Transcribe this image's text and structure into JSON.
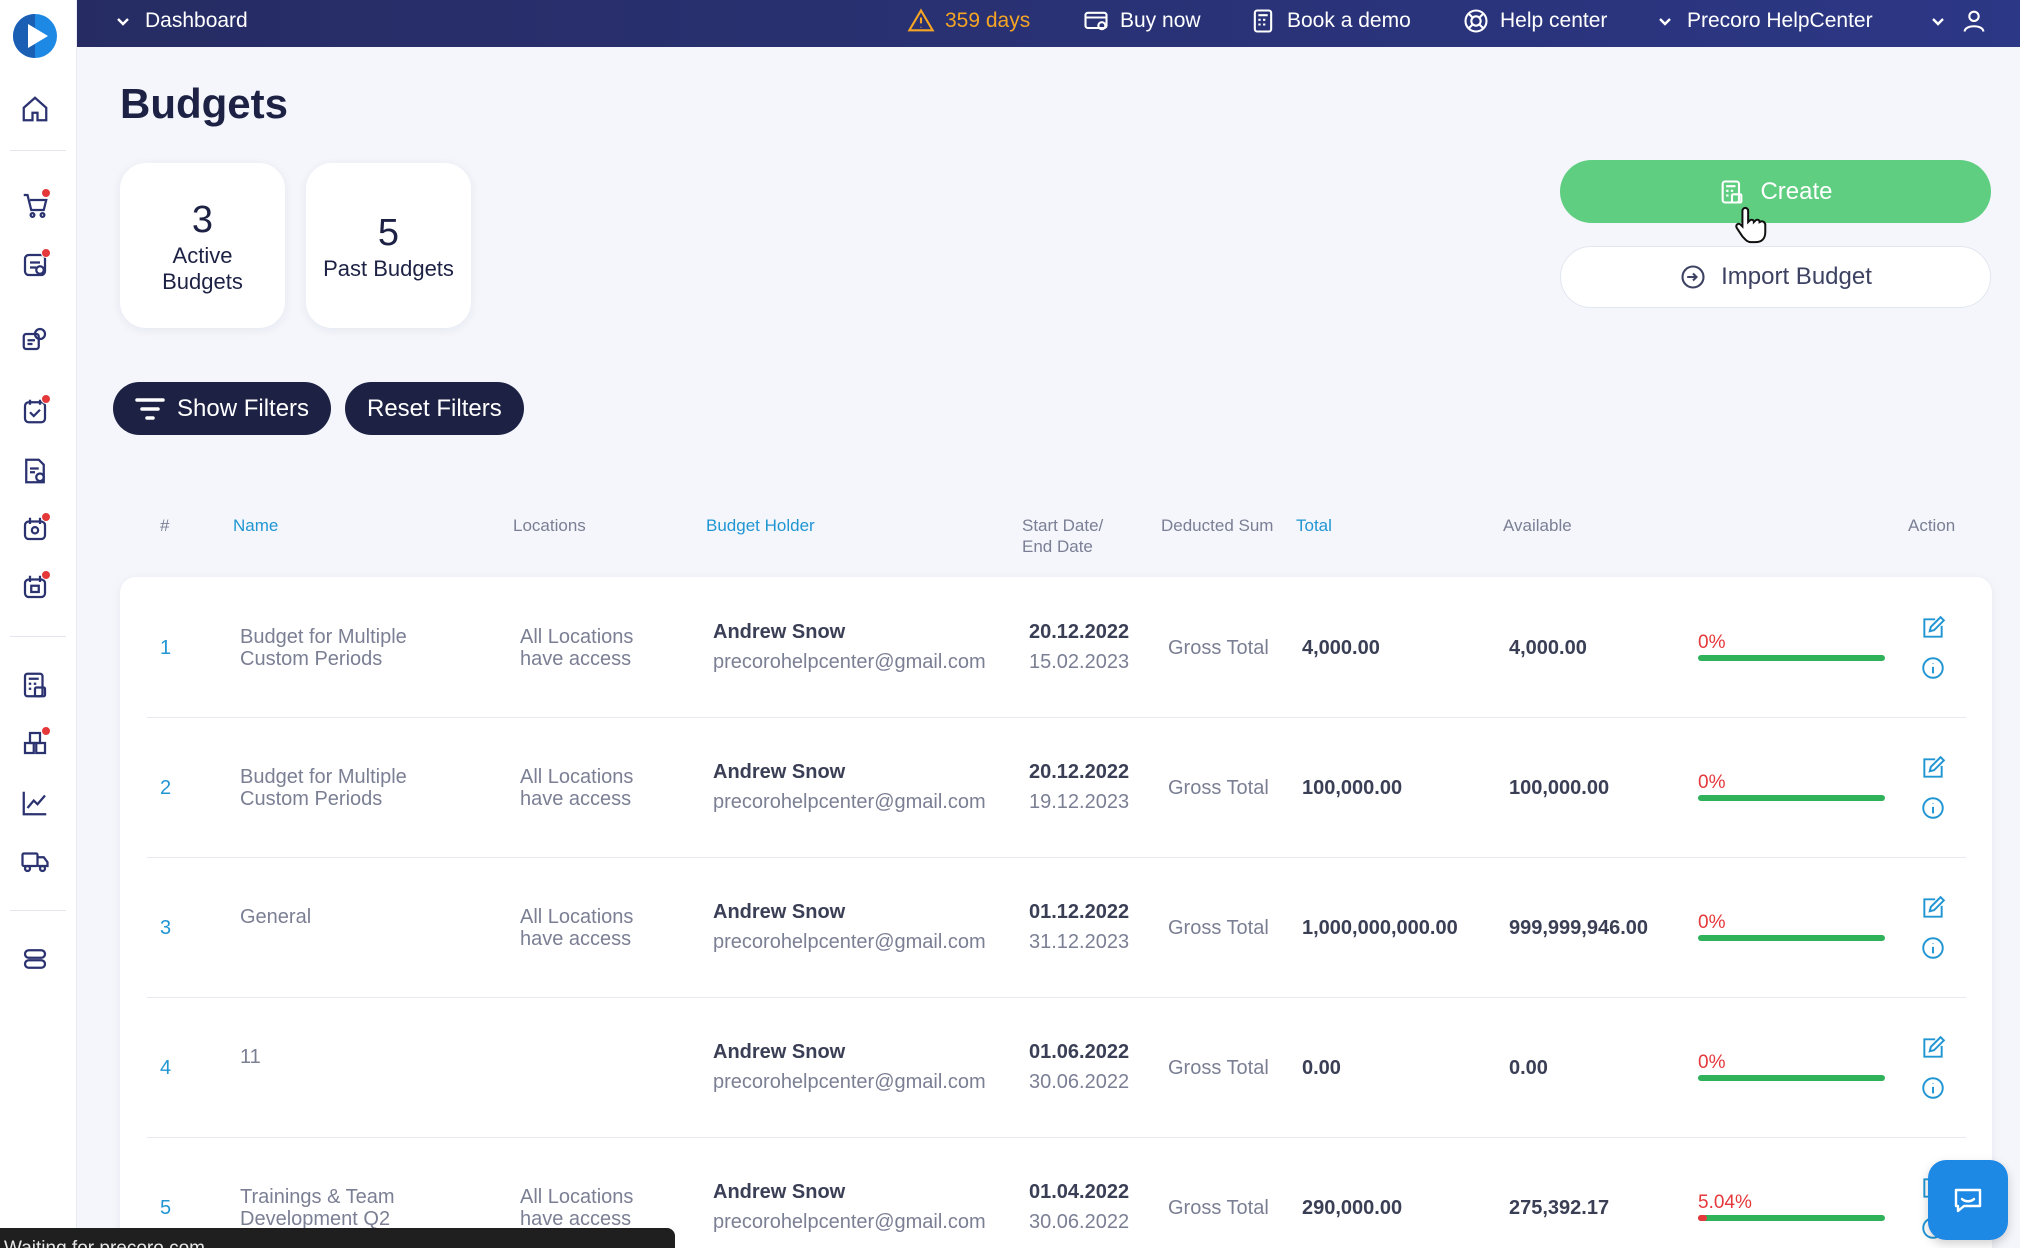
{
  "topbar": {
    "dashboard_label": "Dashboard",
    "trial_days": "359 days",
    "buy_now": "Buy now",
    "book_demo": "Book a demo",
    "help_center": "Help center",
    "company": "Precoro HelpCenter"
  },
  "page": {
    "title": "Budgets"
  },
  "stats": [
    {
      "value": "3",
      "label": "Active Budgets"
    },
    {
      "value": "5",
      "label": "Past Budgets"
    }
  ],
  "actions": {
    "create": "Create",
    "import": "Import Budget"
  },
  "filters": {
    "show": "Show Filters",
    "reset": "Reset Filters"
  },
  "columns": {
    "num": "#",
    "name": "Name",
    "locations": "Locations",
    "holder": "Budget Holder",
    "dates": "Start Date/ End Date",
    "deducted": "Deducted Sum",
    "total": "Total",
    "available": "Available",
    "action": "Action"
  },
  "rows": [
    {
      "num": "1",
      "name": "Budget for Multiple Custom Periods",
      "locations": "All Locations have access",
      "holder": "Andrew Snow",
      "email": "precorohelpcenter@gmail.com",
      "start": "20.12.2022",
      "end": "15.02.2023",
      "deducted": "Gross Total",
      "total": "4,000.00",
      "available": "4,000.00",
      "pct": "0%",
      "pct_value": 0
    },
    {
      "num": "2",
      "name": "Budget for Multiple Custom Periods",
      "locations": "All Locations have access",
      "holder": "Andrew Snow",
      "email": "precorohelpcenter@gmail.com",
      "start": "20.12.2022",
      "end": "19.12.2023",
      "deducted": "Gross Total",
      "total": "100,000.00",
      "available": "100,000.00",
      "pct": "0%",
      "pct_value": 0
    },
    {
      "num": "3",
      "name": "General",
      "locations": "All Locations have access",
      "holder": "Andrew Snow",
      "email": "precorohelpcenter@gmail.com",
      "start": "01.12.2022",
      "end": "31.12.2023",
      "deducted": "Gross Total",
      "total": "1,000,000,000.00",
      "available": "999,999,946.00",
      "pct": "0%",
      "pct_value": 0
    },
    {
      "num": "4",
      "name": "11",
      "locations": "",
      "holder": "Andrew Snow",
      "email": "precorohelpcenter@gmail.com",
      "start": "01.06.2022",
      "end": "30.06.2022",
      "deducted": "Gross Total",
      "total": "0.00",
      "available": "0.00",
      "pct": "0%",
      "pct_value": 0
    },
    {
      "num": "5",
      "name": "Trainings & Team Development Q2",
      "locations": "All Locations have access",
      "holder": "Andrew Snow",
      "email": "precorohelpcenter@gmail.com",
      "start": "01.04.2022",
      "end": "30.06.2022",
      "deducted": "Gross Total",
      "total": "290,000.00",
      "available": "275,392.17",
      "pct": "5.04%",
      "pct_value": 5.04
    }
  ],
  "status_text": "Waiting for precoro.com...",
  "colors": {
    "accent": "#2196d3",
    "create": "#5fce80",
    "navy": "#1d2245",
    "danger": "#e5383b",
    "progress": "#2fb25a"
  }
}
